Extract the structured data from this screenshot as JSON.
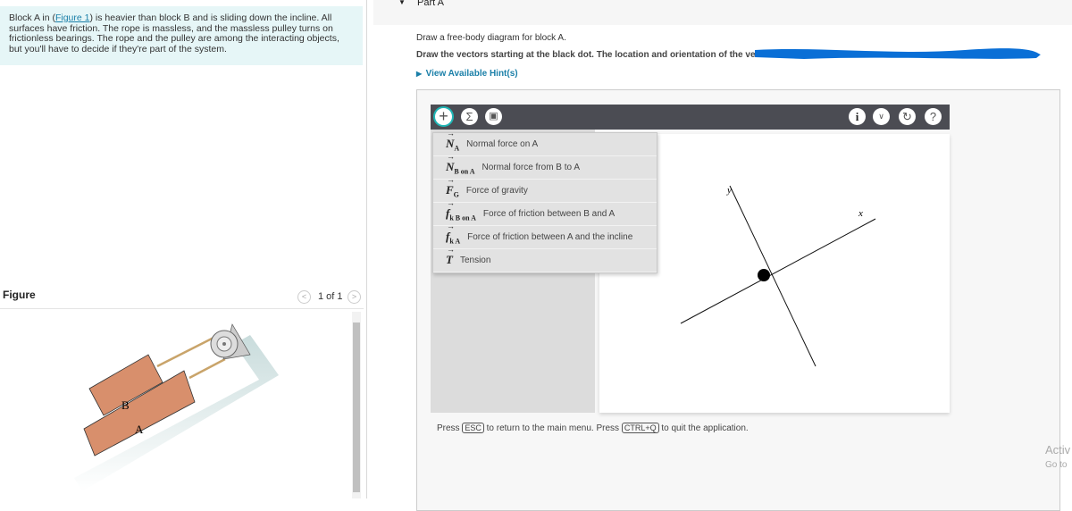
{
  "problem": {
    "text_before": "Block A in (",
    "link": "Figure 1",
    "text_after": ") is heavier than block B and is sliding down the incline. All surfaces have friction. The rope is massless, and the massless pulley turns on frictionless bearings. The rope and the pulley are among the interacting objects, but you'll have to decide if they're part of the system."
  },
  "figure": {
    "label": "Figure",
    "pager": "1 of 1",
    "block_a": "A",
    "block_b": "B"
  },
  "part": {
    "title": "Part A",
    "instruction1": "Draw a free-body diagram for block A.",
    "instruction2": "Draw the vectors starting at the black dot. The location and orientation of the vectors",
    "hint": "View Available Hint(s)"
  },
  "toolbar": {
    "left_icons": [
      "plus-icon",
      "sigma-icon",
      "trash-icon"
    ],
    "right_icons": [
      "info-icon",
      "chevron-down-icon",
      "reset-icon",
      "help-icon"
    ],
    "accent": "#1fb5b5"
  },
  "menu": [
    {
      "sym": "N",
      "sub": "A",
      "label": "Normal force on A"
    },
    {
      "sym": "N",
      "sub": "B on A",
      "label": "Normal force from B to A"
    },
    {
      "sym": "F",
      "sub": "G",
      "label": "Force of gravity"
    },
    {
      "sym": "f",
      "sub": "k B on A",
      "label": "Force of friction between B and A"
    },
    {
      "sym": "f",
      "sub": "k A",
      "label": "Force of friction between A and the incline"
    },
    {
      "sym": "T",
      "sub": "",
      "label": "Tension"
    }
  ],
  "canvas": {
    "y_label": "y",
    "x_label": "x"
  },
  "footer": {
    "p1": "Press ",
    "esc": "ESC",
    "p2": " to return to the main menu. Press ",
    "ctrlq": "CTRL+Q",
    "p3": " to quit the application."
  },
  "watermark": {
    "line1": "Activ",
    "line2": "Go to"
  }
}
